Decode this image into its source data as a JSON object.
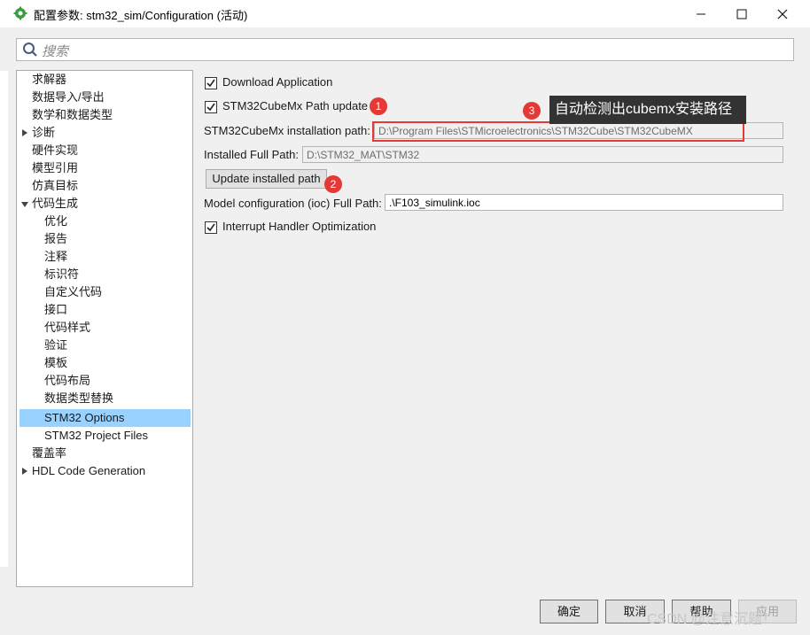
{
  "window": {
    "title": "配置参数: stm32_sim/Configuration (活动)",
    "app_icon": "matlab-gear-icon",
    "controls": {
      "minimize": "—",
      "maximize": "☐",
      "close": "✕"
    }
  },
  "search": {
    "placeholder": "搜索",
    "icon": "search-icon"
  },
  "tree": {
    "items": [
      {
        "label": "求解器"
      },
      {
        "label": "数据导入/导出"
      },
      {
        "label": "数学和数据类型"
      },
      {
        "label": "诊断",
        "expander": "collapsed"
      },
      {
        "label": "硬件实现"
      },
      {
        "label": "模型引用"
      },
      {
        "label": "仿真目标"
      },
      {
        "label": "代码生成",
        "expander": "expanded"
      },
      {
        "label": "优化"
      },
      {
        "label": "报告"
      },
      {
        "label": "注释"
      },
      {
        "label": "标识符"
      },
      {
        "label": "自定义代码"
      },
      {
        "label": "接口"
      },
      {
        "label": "代码样式"
      },
      {
        "label": "验证"
      },
      {
        "label": "模板"
      },
      {
        "label": "代码布局"
      },
      {
        "label": "数据类型替换"
      },
      {
        "label": "STM32 Options",
        "selected": true
      },
      {
        "label": "STM32 Project Files"
      },
      {
        "label": "覆盖率"
      },
      {
        "label": "HDL Code Generation",
        "expander": "collapsed"
      }
    ]
  },
  "options": {
    "download_application": {
      "label": "Download Application",
      "checked": true
    },
    "path_update": {
      "label": "STM32CubeMx Path update",
      "checked": true
    },
    "install_path": {
      "label": "STM32CubeMx installation path:",
      "value": "D:\\Program Files\\STMicroelectronics\\STM32Cube\\STM32CubeMX"
    },
    "installed_full_path": {
      "label": "Installed Full Path:",
      "value": "D:\\STM32_MAT\\STM32"
    },
    "update_button": "Update installed path",
    "model_config": {
      "label": "Model configuration (ioc) Full Path:",
      "value": ".\\F103_simulink.ioc"
    },
    "interrupt_opt": {
      "label": "Interrupt Handler Optimization",
      "checked": true
    }
  },
  "annotations": {
    "badge1": "1",
    "badge2": "2",
    "badge3": "3",
    "tooltip": "自动检测出cubemx安装路径",
    "accent_red": "#e53935"
  },
  "buttons": {
    "ok": "确定",
    "cancel": "取消",
    "help": "帮助",
    "apply": "应用"
  },
  "watermark": "CSDN @注意沉题！",
  "colors": {
    "selection": "#99d1ff",
    "window_bg": "#f0f0f0"
  }
}
